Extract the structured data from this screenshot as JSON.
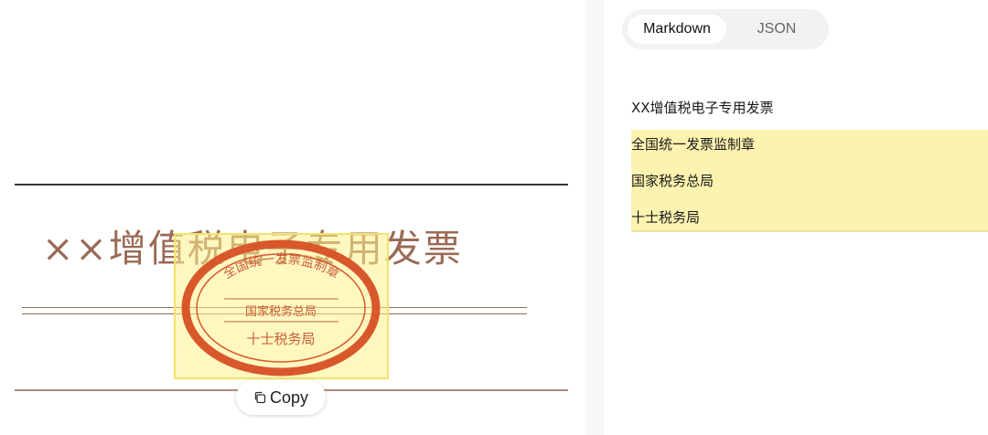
{
  "document": {
    "invoice_title": "××增值税电子专用发票",
    "seal": {
      "line1": "全国统一发票监制章",
      "line2": "国家税务总局",
      "line3": "十士税务局",
      "color": "#d9582b"
    },
    "copy_button_label": "Copy",
    "copy_icon": "copy-icon",
    "highlight_color": "#fff4b0"
  },
  "output": {
    "tabs": [
      {
        "label": "Markdown",
        "active": true
      },
      {
        "label": "JSON",
        "active": false
      }
    ],
    "lines": [
      "XX增值税电子专用发票",
      "全国统一发票监制章",
      "国家税务总局",
      "十士税务局"
    ],
    "highlight_color": "#fdf3b0"
  }
}
